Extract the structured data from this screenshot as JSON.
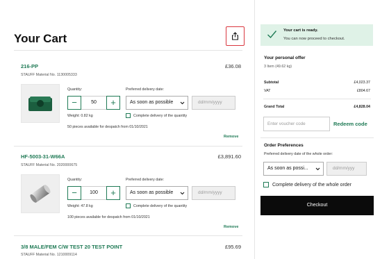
{
  "page": {
    "title": "Your Cart"
  },
  "labels": {
    "quantity": "Quantity:",
    "preferred_date": "Preferred delivery date:",
    "complete_delivery": "Complete delivery of the quantity",
    "remove": "Remove",
    "date_placeholder": "dd/mm/yyyy"
  },
  "items": [
    {
      "name": "216-PP",
      "material": "STAUFF Material No. 1130005333",
      "price": "£36.08",
      "quantity": "50",
      "delivery": "As soon as possible",
      "weight": "Weight: 0.82 kg",
      "availability": "50 pieces available for despatch from 01/10/2021"
    },
    {
      "name": "HF-5003-31-W66A",
      "material": "STAUFF Material No. 2020000675",
      "price": "£3,891.60",
      "quantity": "100",
      "delivery": "As soon as possible",
      "weight": "Weight: 47.8 kg",
      "availability": "100 pieces available for despatch from 01/10/2021"
    },
    {
      "name": "3/8 MALE/FEM C/W TEST 20 TEST POINT",
      "material": "STAUFF Material No. 1210009114",
      "price": "£95.69"
    }
  ],
  "sidebar": {
    "ready_title": "Your cart is ready.",
    "ready_text": "You can now proceed to checkout.",
    "offer_title": "Your personal offer",
    "offer_sub": "3 Item (49.62 kg)",
    "subtotal_label": "Subtotal",
    "subtotal_value": "£4,023.37",
    "vat_label": "VAT",
    "vat_value": "£804.67",
    "grand_label": "Grand Total",
    "grand_value": "£4,828.04",
    "voucher_placeholder": "Enter voucher code",
    "redeem": "Redeem code",
    "pref_title": "Order Preferences",
    "pref_sub": "Preferred delivery date of the whole order:",
    "pref_select": "As soon as possi...",
    "pref_date_placeholder": "dd/mm/yyy",
    "pref_complete": "Complete delivery of the whole order",
    "checkout": "Checkout"
  },
  "colors": {
    "accent": "#1f7a55",
    "share_border": "#d9363e",
    "banner_bg": "#dff2e7",
    "checkout_bg": "#0b0b0b"
  }
}
